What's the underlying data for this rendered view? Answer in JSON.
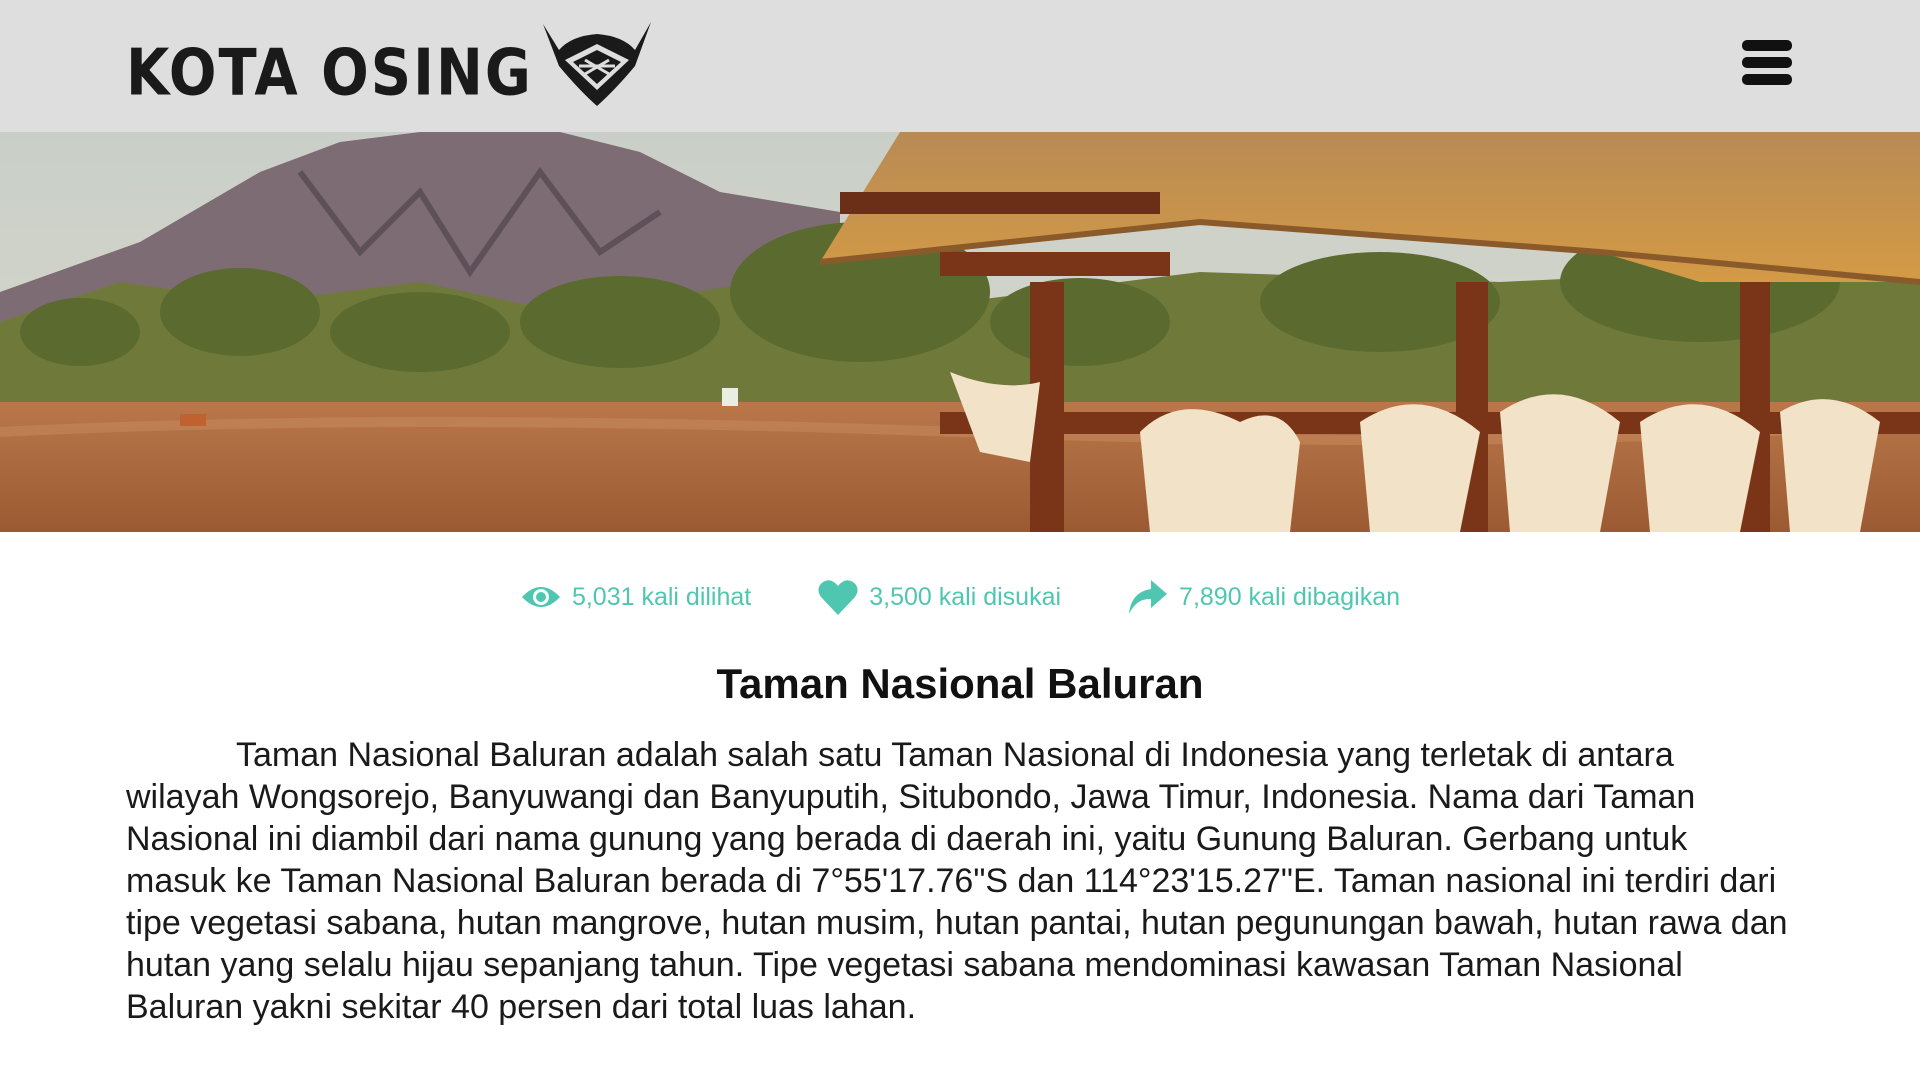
{
  "header": {
    "logo_text": "KOTA OSING",
    "menu_icon": "hamburger-menu-icon"
  },
  "hero": {
    "image_subject": "savanna landscape with mountain, thatched shelter and animal skulls"
  },
  "stats": {
    "views": {
      "icon": "eye-icon",
      "label": "5,031 kali dilihat"
    },
    "likes": {
      "icon": "heart-icon",
      "label": "3,500 kali disukai"
    },
    "shares": {
      "icon": "share-arrow-icon",
      "label": "7,890 kali dibagikan"
    },
    "color": "#4fc7b0"
  },
  "article": {
    "title": "Taman Nasional Baluran",
    "body": "Taman Nasional Baluran adalah salah satu Taman Nasional di Indonesia yang terletak di antara wilayah Wongsorejo, Banyuwangi dan Banyuputih, Situbondo, Jawa Timur, Indonesia. Nama dari Taman Nasional ini diambil dari nama gunung yang berada di daerah ini, yaitu Gunung Baluran. Gerbang untuk masuk ke Taman Nasional Baluran berada di 7°55'17.76\"S dan 114°23'15.27\"E. Taman nasional ini terdiri dari tipe vegetasi sabana, hutan mangrove, hutan musim, hutan pantai, hutan pegunungan bawah, hutan rawa dan hutan yang selalu hijau sepanjang tahun. Tipe vegetasi sabana mendominasi kawasan Taman Nasional Baluran yakni sekitar 40 persen dari total luas lahan."
  }
}
